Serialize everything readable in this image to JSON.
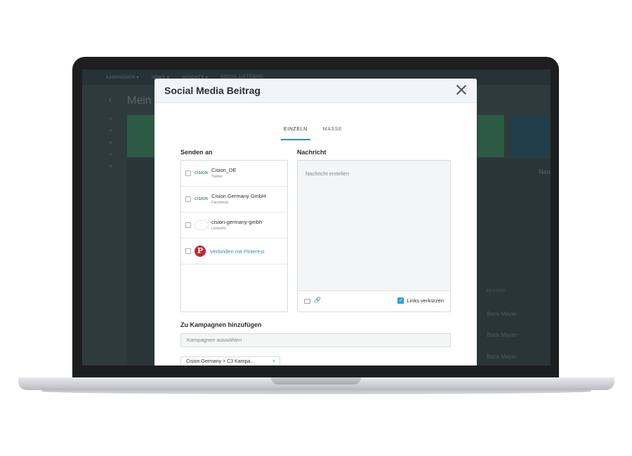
{
  "background_app": {
    "nav_items": [
      "KAMPAGNEN ▾",
      "NEWS ▾",
      "INSIGHTS ▾",
      "SOCIAL LISTENING"
    ],
    "page_title": "Mein",
    "back_symbol": "‹",
    "column_header": "BESITZER",
    "owner_rows": [
      "Boris Mayer",
      "Boris Mayer",
      "Boris Mayer"
    ],
    "right_heading": "Neu"
  },
  "modal": {
    "title": "Social Media Beitrag",
    "tabs": [
      {
        "label": "EINZELN",
        "active": true
      },
      {
        "label": "MASSE",
        "active": false
      }
    ],
    "send_to_label": "Senden an",
    "message_label": "Nachricht",
    "accounts": [
      {
        "name": "Cision_DE",
        "network": "Twitter",
        "logo": "CISION"
      },
      {
        "name": "Cision Germany GmbH",
        "network": "Facebook",
        "logo": "CISION"
      },
      {
        "name": "cision-germany-gmbh",
        "network": "LinkedIn",
        "logo": ""
      }
    ],
    "connect_pinterest": "Verbinden mit Pinterest",
    "pinterest_icon": "P",
    "message_placeholder": "Nachricht erstellen",
    "shorten_links_label": "Links verkürzen",
    "shorten_links_checked": true,
    "campaigns_label": "Zu Kampagnen hinzufügen",
    "campaigns_placeholder": "Kampagnen auswählen",
    "campaign_chip": "Cision Germany > C3 Kampa...",
    "chip_remove": "×"
  },
  "colors": {
    "accent": "#2f8fc1",
    "pinterest_red": "#c9252c",
    "cision_green": "#2e8a7a"
  }
}
